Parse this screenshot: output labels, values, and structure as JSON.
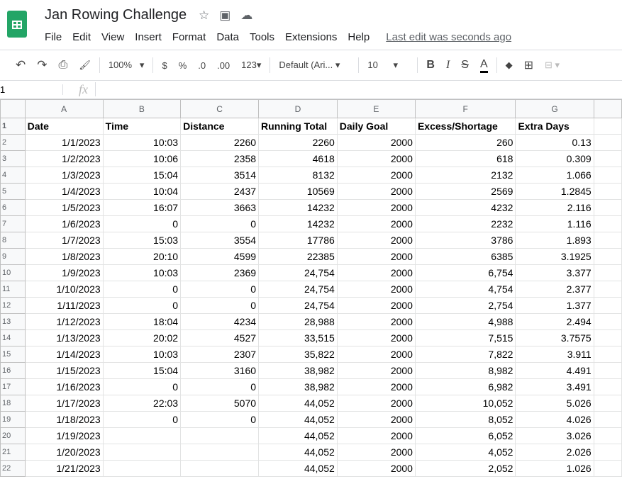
{
  "app": {
    "title": "Jan Rowing Challenge",
    "last_edit": "Last edit was seconds ago",
    "menu": [
      "File",
      "Edit",
      "View",
      "Insert",
      "Format",
      "Data",
      "Tools",
      "Extensions",
      "Help"
    ]
  },
  "toolbar": {
    "zoom": "100%",
    "currency": "$",
    "percent": "%",
    "dec_less": ".0",
    "dec_more": ".00",
    "format": "123",
    "font": "Default (Ari...",
    "size": "10",
    "bold": "B",
    "italic": "I",
    "strike": "S",
    "textcolor": "A"
  },
  "formula_bar": {
    "name_box": "1",
    "fx": "fx",
    "value": ""
  },
  "columns": [
    "A",
    "B",
    "C",
    "D",
    "E",
    "F",
    "G"
  ],
  "headers": [
    "Date",
    "Time",
    "Distance",
    "Running Total",
    "Daily Goal",
    "Excess/Shortage",
    "Extra Days"
  ],
  "rows": [
    [
      "1/1/2023",
      "10:03",
      "2260",
      "2260",
      "2000",
      "260",
      "0.13"
    ],
    [
      "1/2/2023",
      "10:06",
      "2358",
      "4618",
      "2000",
      "618",
      "0.309"
    ],
    [
      "1/3/2023",
      "15:04",
      "3514",
      "8132",
      "2000",
      "2132",
      "1.066"
    ],
    [
      "1/4/2023",
      "10:04",
      "2437",
      "10569",
      "2000",
      "2569",
      "1.2845"
    ],
    [
      "1/5/2023",
      "16:07",
      "3663",
      "14232",
      "2000",
      "4232",
      "2.116"
    ],
    [
      "1/6/2023",
      "0",
      "0",
      "14232",
      "2000",
      "2232",
      "1.116"
    ],
    [
      "1/7/2023",
      "15:03",
      "3554",
      "17786",
      "2000",
      "3786",
      "1.893"
    ],
    [
      "1/8/2023",
      "20:10",
      "4599",
      "22385",
      "2000",
      "6385",
      "3.1925"
    ],
    [
      "1/9/2023",
      "10:03",
      "2369",
      "24,754",
      "2000",
      "6,754",
      "3.377"
    ],
    [
      "1/10/2023",
      "0",
      "0",
      "24,754",
      "2000",
      "4,754",
      "2.377"
    ],
    [
      "1/11/2023",
      "0",
      "0",
      "24,754",
      "2000",
      "2,754",
      "1.377"
    ],
    [
      "1/12/2023",
      "18:04",
      "4234",
      "28,988",
      "2000",
      "4,988",
      "2.494"
    ],
    [
      "1/13/2023",
      "20:02",
      "4527",
      "33,515",
      "2000",
      "7,515",
      "3.7575"
    ],
    [
      "1/14/2023",
      "10:03",
      "2307",
      "35,822",
      "2000",
      "7,822",
      "3.911"
    ],
    [
      "1/15/2023",
      "15:04",
      "3160",
      "38,982",
      "2000",
      "8,982",
      "4.491"
    ],
    [
      "1/16/2023",
      "0",
      "0",
      "38,982",
      "2000",
      "6,982",
      "3.491"
    ],
    [
      "1/17/2023",
      "22:03",
      "5070",
      "44,052",
      "2000",
      "10,052",
      "5.026"
    ],
    [
      "1/18/2023",
      "0",
      "0",
      "44,052",
      "2000",
      "8,052",
      "4.026"
    ],
    [
      "1/19/2023",
      "",
      "",
      "44,052",
      "2000",
      "6,052",
      "3.026"
    ],
    [
      "1/20/2023",
      "",
      "",
      "44,052",
      "2000",
      "4,052",
      "2.026"
    ],
    [
      "1/21/2023",
      "",
      "",
      "44,052",
      "2000",
      "2,052",
      "1.026"
    ]
  ]
}
